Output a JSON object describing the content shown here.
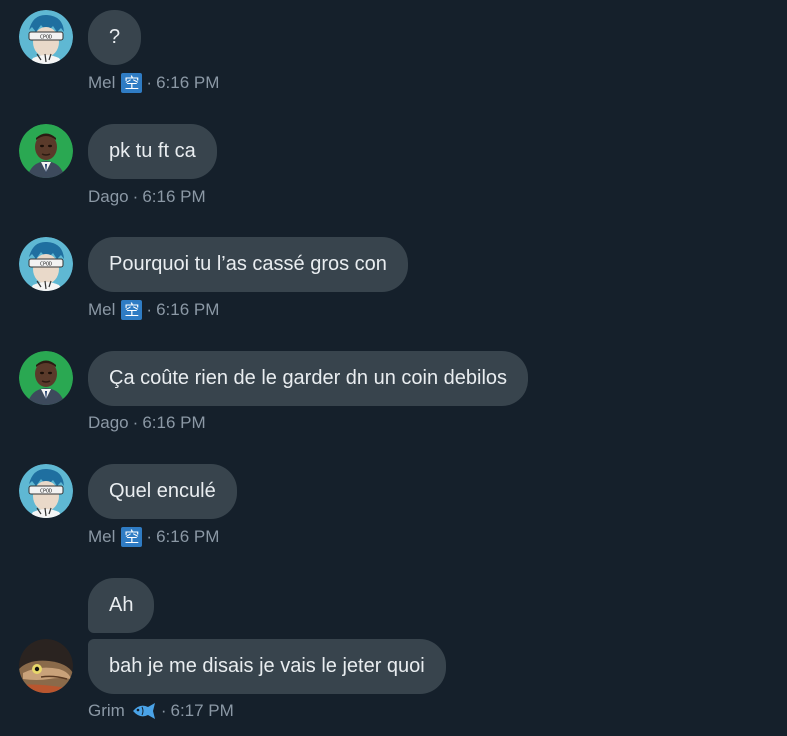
{
  "messages": [
    {
      "author": "Mel",
      "badge": "空",
      "time": "6:16 PM",
      "avatar": "anime-avatar",
      "bubbles": [
        "?"
      ]
    },
    {
      "author": "Dago",
      "time": "6:16 PM",
      "avatar": "man-green-avatar",
      "bubbles": [
        "pk tu ft ca"
      ]
    },
    {
      "author": "Mel",
      "badge": "空",
      "time": "6:16 PM",
      "avatar": "anime-avatar",
      "bubbles": [
        "Pourquoi tu l’as cassé gros con"
      ]
    },
    {
      "author": "Dago",
      "time": "6:16 PM",
      "avatar": "man-green-avatar",
      "bubbles": [
        "Ça coûte rien de le garder dn un coin debilos"
      ]
    },
    {
      "author": "Mel",
      "badge": "空",
      "time": "6:16 PM",
      "avatar": "anime-avatar",
      "bubbles": [
        "Quel enculé"
      ]
    },
    {
      "author": "Grim",
      "badge_icon": "fish-icon",
      "time": "6:17 PM",
      "avatar": "lizard-avatar",
      "bubbles": [
        "Ah",
        "bah je me disais je vais le jeter quoi"
      ]
    }
  ],
  "separator": "·",
  "colors": {
    "background": "#15202b",
    "bubble": "#38444d",
    "text": "#e9edf0",
    "meta": "#8b98a5",
    "badge": "#2f7cc4"
  }
}
